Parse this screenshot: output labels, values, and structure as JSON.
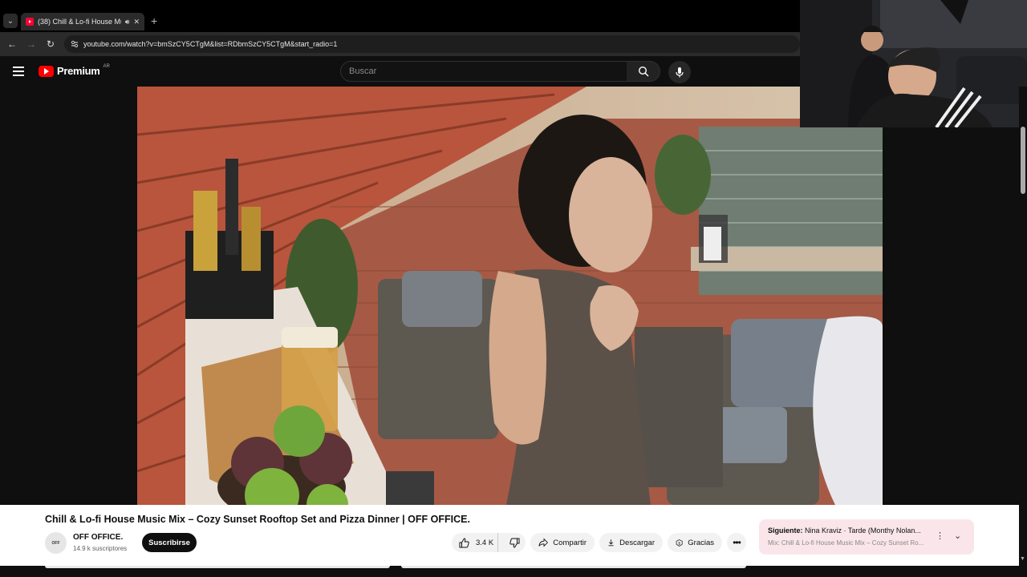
{
  "browser": {
    "tab_title": "(38) Chill & Lo-fi House Mu",
    "tab_audio_icon": "speaker-icon",
    "tab_close_icon": "close-icon",
    "new_tab_label": "+",
    "url": "youtube.com/watch?v=bmSzCY5CTgM&list=RDbmSzCY5CTgM&start_radio=1"
  },
  "youtube": {
    "logo_text": "Premium",
    "logo_country": "AR",
    "search_placeholder": "Buscar"
  },
  "video": {
    "title": "Chill & Lo-fi House Music Mix – Cozy Sunset Rooftop Set and Pizza Dinner | OFF OFFICE.",
    "channel_avatar_text": "OFF",
    "channel_name": "OFF OFFICE.",
    "subscribers": "14.9 k suscriptores",
    "subscribe_label": "Suscribirse",
    "likes": "3.4 K",
    "share_label": "Compartir",
    "download_label": "Descargar",
    "thanks_label": "Gracias"
  },
  "up_next": {
    "prefix": "Siguiente:",
    "track": "Nina Kraviz · Tarde (Monthy Nolan...",
    "mix_title": "Mix: Chill & Lo-fi House Music Mix – Cozy Sunset Ro..."
  },
  "colors": {
    "youtube_red": "#ff0000",
    "up_next_bg": "#fae6ea",
    "page_bg": "#0f0f0f"
  }
}
